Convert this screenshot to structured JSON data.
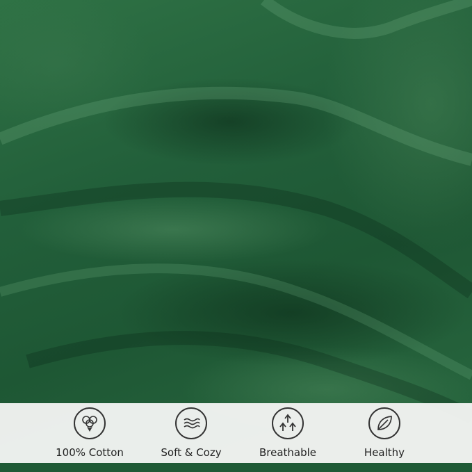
{
  "image": {
    "subject": "green-cotton-fabric",
    "fabric_color": "#2a6a41"
  },
  "features": [
    {
      "label": "100% Cotton",
      "icon": "cotton-boll-icon"
    },
    {
      "label": "Soft & Cozy",
      "icon": "soft-waves-icon"
    },
    {
      "label": "Breathable",
      "icon": "breathable-arrows-icon"
    },
    {
      "label": "Healthy",
      "icon": "leaf-icon"
    }
  ],
  "colors": {
    "bar_background": "#f6f6f4",
    "icon_stroke": "#333333",
    "text": "#222222"
  }
}
